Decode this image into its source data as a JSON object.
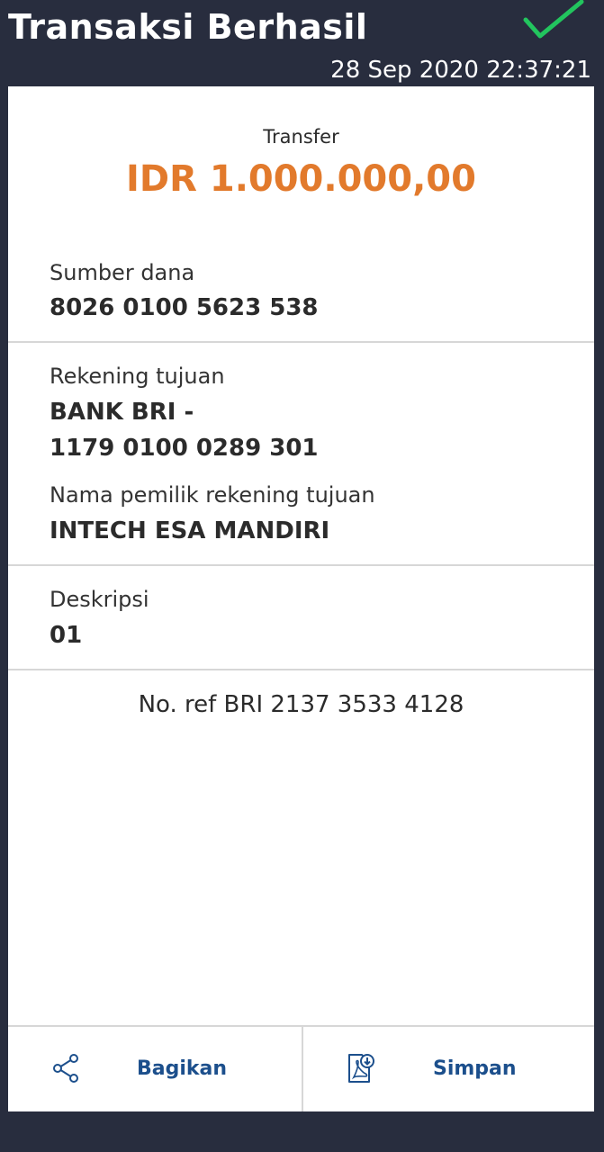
{
  "header": {
    "title": "Transaksi Berhasil",
    "timestamp": "28 Sep 2020 22:37:21",
    "status_icon": "check-icon",
    "status_color": "#22c55e"
  },
  "summary": {
    "type": "Transfer",
    "amount": "IDR 1.000.000,00",
    "amount_color": "#e27a2c"
  },
  "details": {
    "source_label": "Sumber dana",
    "source_value": "8026 0100 5623 538",
    "dest_label": "Rekening tujuan",
    "dest_bank": "BANK BRI -",
    "dest_account": "1179 0100 0289 301",
    "owner_label": "Nama pemilik rekening tujuan",
    "owner_value": "INTECH ESA MANDIRI",
    "desc_label": "Deskripsi",
    "desc_value": "01",
    "reference": "No. ref BRI 2137 3533 4128"
  },
  "actions": {
    "share_label": "Bagikan",
    "share_icon": "share-icon",
    "save_label": "Simpan",
    "save_icon": "pdf-download-icon",
    "action_color": "#1c4f8c"
  }
}
